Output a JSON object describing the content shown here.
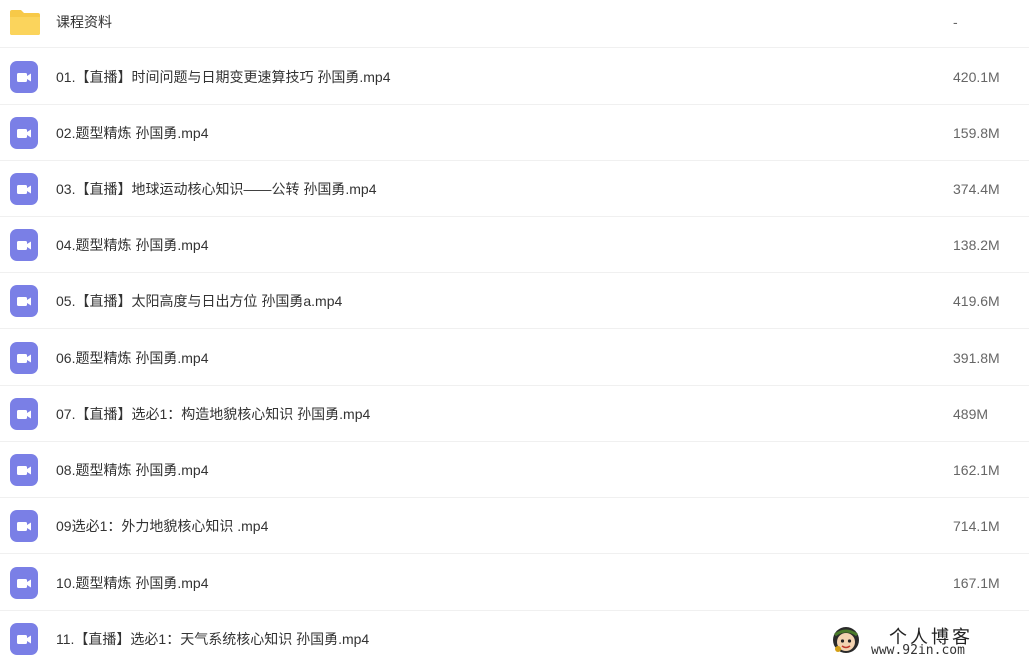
{
  "files": [
    {
      "name": "课程资料",
      "size": "-",
      "type": "folder"
    },
    {
      "name": "01.【直播】时间问题与日期变更速算技巧 孙国勇.mp4",
      "size": "420.1M",
      "type": "video"
    },
    {
      "name": "02.题型精炼 孙国勇.mp4",
      "size": "159.8M",
      "type": "video"
    },
    {
      "name": "03.【直播】地球运动核心知识——公转 孙国勇.mp4",
      "size": "374.4M",
      "type": "video"
    },
    {
      "name": "04.题型精炼 孙国勇.mp4",
      "size": "138.2M",
      "type": "video"
    },
    {
      "name": "05.【直播】太阳高度与日出方位 孙国勇a.mp4",
      "size": "419.6M",
      "type": "video"
    },
    {
      "name": "06.题型精炼 孙国勇.mp4",
      "size": "391.8M",
      "type": "video"
    },
    {
      "name": "07.【直播】选必1：构造地貌核心知识 孙国勇.mp4",
      "size": "489M",
      "type": "video"
    },
    {
      "name": "08.题型精炼 孙国勇.mp4",
      "size": "162.1M",
      "type": "video"
    },
    {
      "name": "09选必1：外力地貌核心知识 .mp4",
      "size": "714.1M",
      "type": "video"
    },
    {
      "name": "10.题型精炼 孙国勇.mp4",
      "size": "167.1M",
      "type": "video"
    },
    {
      "name": "11.【直播】选必1：天气系统核心知识 孙国勇.mp4",
      "size": "",
      "type": "video"
    }
  ],
  "watermark": {
    "title": "个人博客",
    "url": "www.92in.com"
  },
  "colors": {
    "folder": "#f7c948",
    "video_icon": "#7a7fe6",
    "text": "#333333",
    "size_text": "#666666",
    "divider": "#f0f0f0"
  },
  "icons": {
    "folder": "folder-icon",
    "video": "video-file-icon",
    "watermark": "mascot-logo"
  }
}
